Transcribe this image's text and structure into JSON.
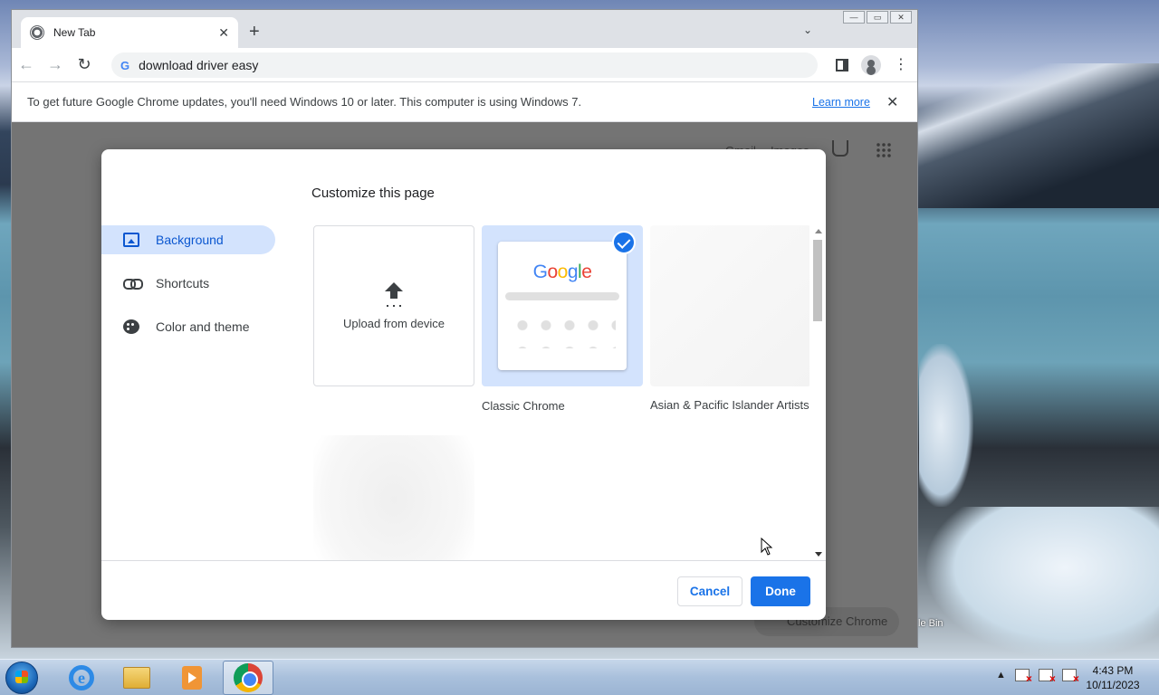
{
  "browser": {
    "tab_title": "New Tab",
    "address": "download driver easy",
    "infobar_message": "To get future Google Chrome updates, you'll need Windows 10 or later. This computer is using Windows 7.",
    "infobar_link": "Learn more"
  },
  "page_bg": {
    "gmail": "Gmail",
    "images": "Images",
    "customize_chip": "Customize Chrome"
  },
  "dialog": {
    "title": "Customize this page",
    "nav": [
      {
        "label": "Background",
        "icon": "background-icon",
        "selected": true
      },
      {
        "label": "Shortcuts",
        "icon": "link-icon",
        "selected": false
      },
      {
        "label": "Color and theme",
        "icon": "palette-icon",
        "selected": false
      }
    ],
    "tiles": {
      "upload_label": "Upload from device",
      "classic_label": "Classic Chrome",
      "classic_logo": "Google",
      "asian_label": "Asian & Pacific Islander Artists"
    },
    "cancel": "Cancel",
    "done": "Done"
  },
  "desktop": {
    "recycle_bin_partial": "le Bin"
  },
  "taskbar": {
    "time": "4:43 PM",
    "date": "10/11/2023",
    "tray_expand": "▲"
  },
  "colors": {
    "accent": "#1a73e8",
    "nav_selected_bg": "#d3e3fd"
  }
}
